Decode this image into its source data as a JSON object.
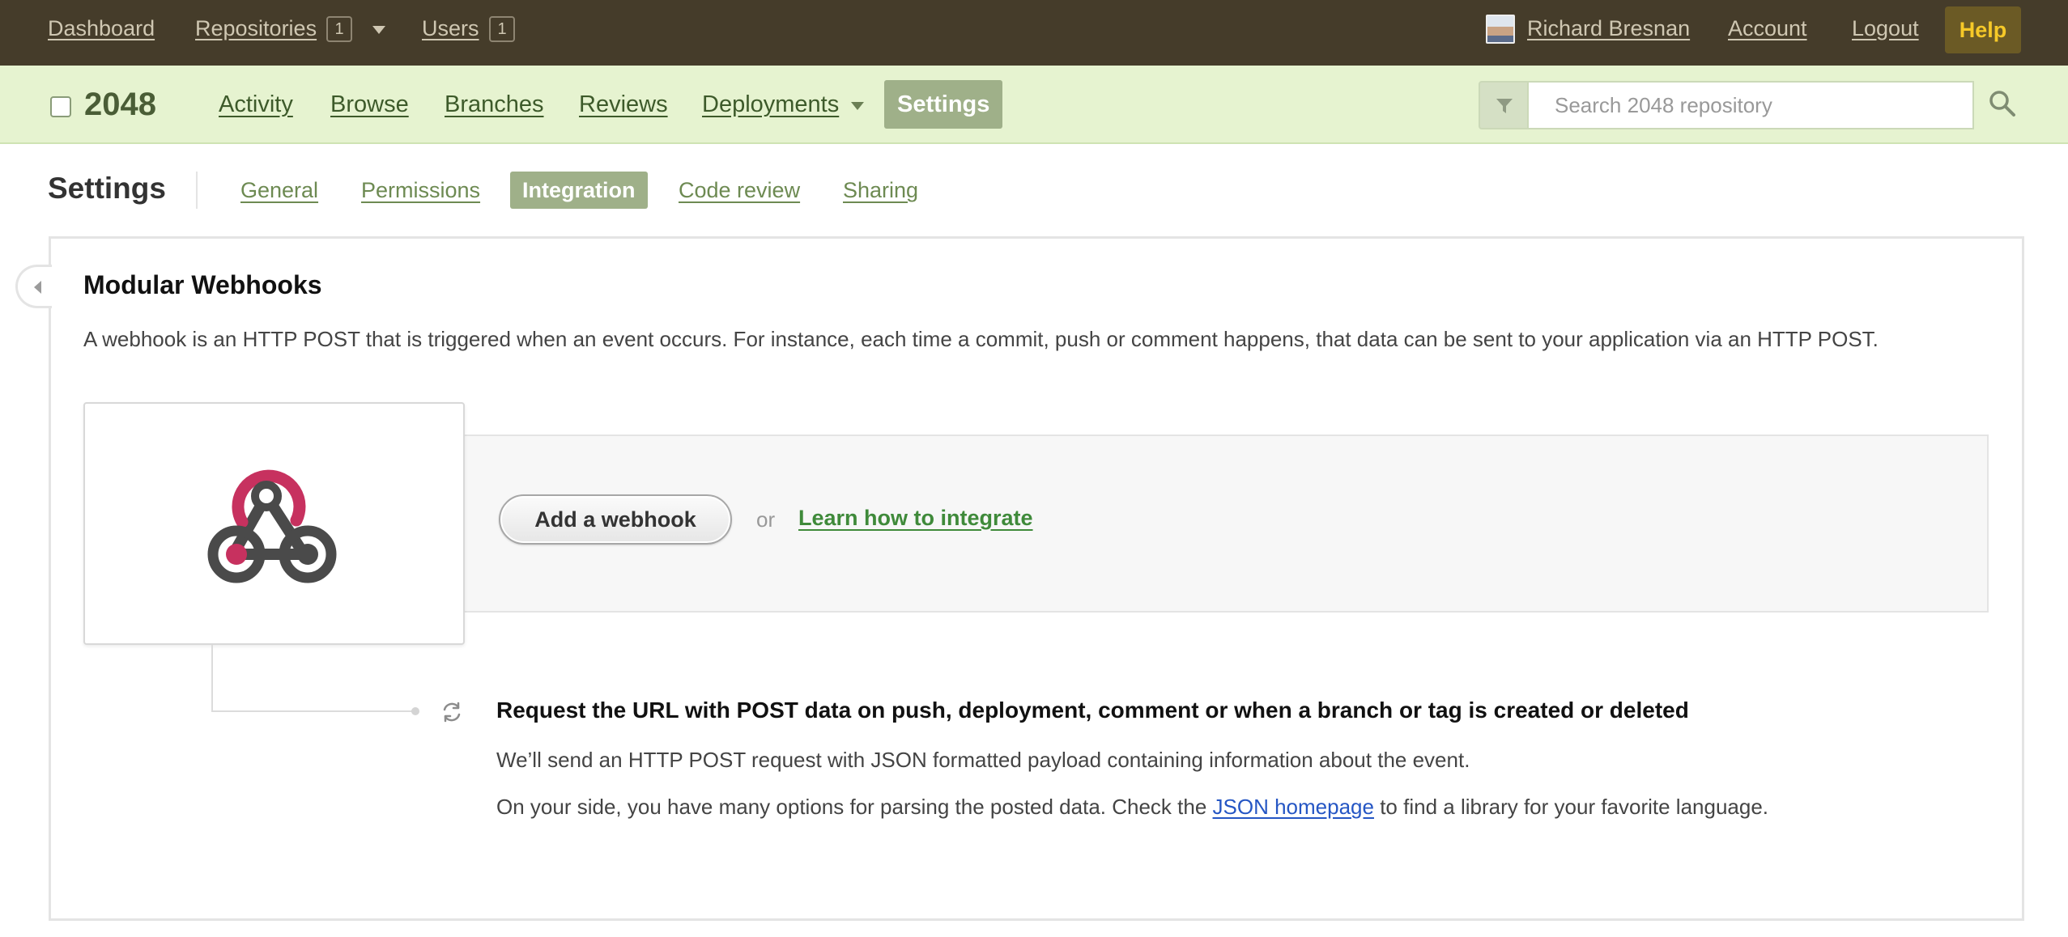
{
  "topbar": {
    "dashboard": "Dashboard",
    "repositories": "Repositories",
    "repositories_count": "1",
    "users": "Users",
    "users_count": "1",
    "user_name": "Richard Bresnan",
    "account": "Account",
    "logout": "Logout",
    "help": "Help"
  },
  "repo": {
    "name": "2048",
    "nav": {
      "activity": "Activity",
      "browse": "Browse",
      "branches": "Branches",
      "reviews": "Reviews",
      "deployments": "Deployments",
      "settings": "Settings"
    },
    "search_placeholder": "Search 2048 repository"
  },
  "settings": {
    "title": "Settings",
    "tabs": {
      "general": "General",
      "permissions": "Permissions",
      "integration": "Integration",
      "code_review": "Code review",
      "sharing": "Sharing"
    },
    "active_tab": "Integration"
  },
  "webhooks": {
    "title": "Modular Webhooks",
    "description": "A webhook is an HTTP POST that is triggered when an event occurs. For instance, each time a commit, push or comment happens, that data can be sent to your application via an HTTP POST.",
    "add_button": "Add a webhook",
    "or": "or",
    "learn_link": "Learn how to integrate",
    "event_title": "Request the URL with POST data on push, deployment, comment or when a branch or tag is created or deleted",
    "event_line1": "We’ll send an HTTP POST request with JSON formatted payload containing information about the event.",
    "event_line2_before": "On your side, you have many options for parsing the posted data. Check the ",
    "event_line2_link": "JSON homepage",
    "event_line2_after": " to find a library for your favorite language."
  },
  "colors": {
    "topbar_bg": "#453c2a",
    "repobar_bg": "#e6f3d0",
    "active_tab_bg": "#9fb089",
    "help_text": "#f6c928",
    "webhook_pink": "#c7315f",
    "webhook_gray": "#4a4a4a",
    "link_green": "#3f8a3a",
    "link_blue": "#2556c4"
  },
  "icons": {
    "filter": "filter-icon",
    "search": "search-icon",
    "refresh": "refresh-icon",
    "collapse": "chevron-left-icon",
    "logo": "webhook-logo-icon"
  }
}
